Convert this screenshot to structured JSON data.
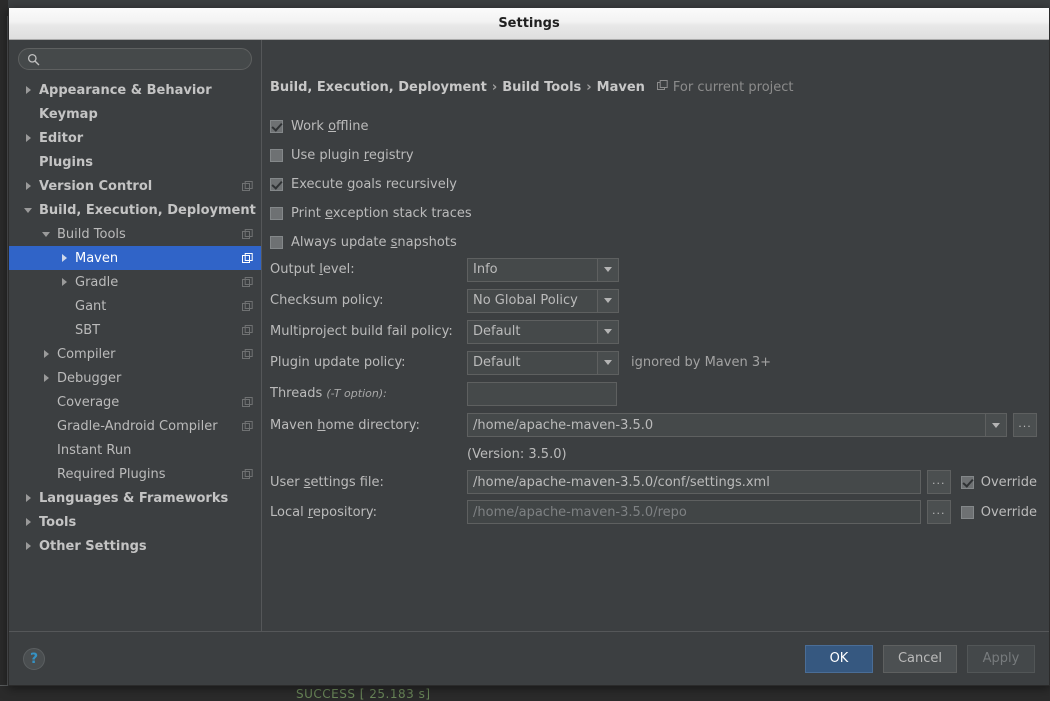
{
  "backdrop": {
    "console_text": "SUCCESS [ 25.183 s]"
  },
  "window": {
    "title": "Settings"
  },
  "search": {
    "value": "",
    "placeholder": "",
    "icon": "search-icon"
  },
  "sidebar": {
    "items": [
      {
        "label": "Appearance & Behavior",
        "indent": 0,
        "arrow": "right",
        "bold": true,
        "scope_icon": false,
        "selected": false
      },
      {
        "label": "Keymap",
        "indent": 0,
        "arrow": "none",
        "bold": true,
        "scope_icon": false,
        "selected": false
      },
      {
        "label": "Editor",
        "indent": 0,
        "arrow": "right",
        "bold": true,
        "scope_icon": false,
        "selected": false
      },
      {
        "label": "Plugins",
        "indent": 0,
        "arrow": "none",
        "bold": true,
        "scope_icon": false,
        "selected": false
      },
      {
        "label": "Version Control",
        "indent": 0,
        "arrow": "right",
        "bold": true,
        "scope_icon": true,
        "selected": false
      },
      {
        "label": "Build, Execution, Deployment",
        "indent": 0,
        "arrow": "down",
        "bold": true,
        "scope_icon": false,
        "selected": false
      },
      {
        "label": "Build Tools",
        "indent": 1,
        "arrow": "down",
        "bold": false,
        "scope_icon": true,
        "selected": false
      },
      {
        "label": "Maven",
        "indent": 2,
        "arrow": "right",
        "bold": false,
        "scope_icon": true,
        "selected": true
      },
      {
        "label": "Gradle",
        "indent": 2,
        "arrow": "right",
        "bold": false,
        "scope_icon": true,
        "selected": false
      },
      {
        "label": "Gant",
        "indent": 2,
        "arrow": "none",
        "bold": false,
        "scope_icon": true,
        "selected": false
      },
      {
        "label": "SBT",
        "indent": 2,
        "arrow": "none",
        "bold": false,
        "scope_icon": true,
        "selected": false
      },
      {
        "label": "Compiler",
        "indent": 1,
        "arrow": "right",
        "bold": false,
        "scope_icon": true,
        "selected": false
      },
      {
        "label": "Debugger",
        "indent": 1,
        "arrow": "right",
        "bold": false,
        "scope_icon": false,
        "selected": false
      },
      {
        "label": "Coverage",
        "indent": 1,
        "arrow": "none",
        "bold": false,
        "scope_icon": true,
        "selected": false
      },
      {
        "label": "Gradle-Android Compiler",
        "indent": 1,
        "arrow": "none",
        "bold": false,
        "scope_icon": true,
        "selected": false
      },
      {
        "label": "Instant Run",
        "indent": 1,
        "arrow": "none",
        "bold": false,
        "scope_icon": false,
        "selected": false
      },
      {
        "label": "Required Plugins",
        "indent": 1,
        "arrow": "none",
        "bold": false,
        "scope_icon": true,
        "selected": false
      },
      {
        "label": "Languages & Frameworks",
        "indent": 0,
        "arrow": "right",
        "bold": true,
        "scope_icon": false,
        "selected": false
      },
      {
        "label": "Tools",
        "indent": 0,
        "arrow": "right",
        "bold": true,
        "scope_icon": false,
        "selected": false
      },
      {
        "label": "Other Settings",
        "indent": 0,
        "arrow": "right",
        "bold": true,
        "scope_icon": false,
        "selected": false
      }
    ]
  },
  "main": {
    "breadcrumb": [
      "Build, Execution, Deployment",
      "Build Tools",
      "Maven"
    ],
    "breadcrumb_separator": "›",
    "scope_note": "For current project",
    "scope_note_icon": "project-scope-icon",
    "checkboxes": [
      {
        "label_before": "Work ",
        "mnemonic": "o",
        "label_after": "ffline",
        "checked": true
      },
      {
        "label_before": "Use plugin ",
        "mnemonic": "r",
        "label_after": "egistry",
        "checked": false
      },
      {
        "label_before": "Execute ",
        "mnemonic": "g",
        "label_after": "oals recursively",
        "checked": true
      },
      {
        "label_before": "Print ",
        "mnemonic": "e",
        "label_after": "xception stack traces",
        "checked": false
      },
      {
        "label_before": "Always update ",
        "mnemonic": "s",
        "label_after": "napshots",
        "checked": false
      }
    ],
    "combos": [
      {
        "label_before": "Output ",
        "mnemonic": "l",
        "label_after": "evel:",
        "value": "Info",
        "hint": ""
      },
      {
        "label_before": "Checksum policy:",
        "mnemonic": "",
        "label_after": "",
        "value": "No Global Policy",
        "hint": ""
      },
      {
        "label_before": "Multiproject build fail policy:",
        "mnemonic": "",
        "label_after": "",
        "value": "Default",
        "hint": ""
      },
      {
        "label_before": "Plugin update policy:",
        "mnemonic": "",
        "label_after": "",
        "value": "Default",
        "hint": "ignored by Maven 3+"
      }
    ],
    "threads": {
      "label": "Threads",
      "label_italic": "(-T option):",
      "value": ""
    },
    "maven_home": {
      "label_before": "Maven ",
      "mnemonic": "h",
      "label_after": "ome directory:",
      "value": "/home/apache-maven-3.5.0",
      "browse_label": "...",
      "version_note": "(Version: 3.5.0)"
    },
    "user_settings": {
      "label_before": "User ",
      "mnemonic": "s",
      "label_after": "ettings file:",
      "value": "/home/apache-maven-3.5.0/conf/settings.xml",
      "browse_label": "...",
      "override_label": "Override",
      "override_checked": true,
      "disabled": false
    },
    "local_repository": {
      "label_before": "Local ",
      "mnemonic": "r",
      "label_after": "epository:",
      "value": "/home/apache-maven-3.5.0/repo",
      "browse_label": "...",
      "override_label": "Override",
      "override_checked": false,
      "disabled": true
    }
  },
  "footer": {
    "help_label": "?",
    "ok_label": "OK",
    "cancel_label": "Cancel",
    "apply_label": "Apply",
    "apply_disabled": true
  },
  "colors": {
    "selection_blue": "#3064c8",
    "panel_bg": "#3c3f41",
    "default_button_bg": "#365880",
    "help_icon": "#3592c4"
  }
}
